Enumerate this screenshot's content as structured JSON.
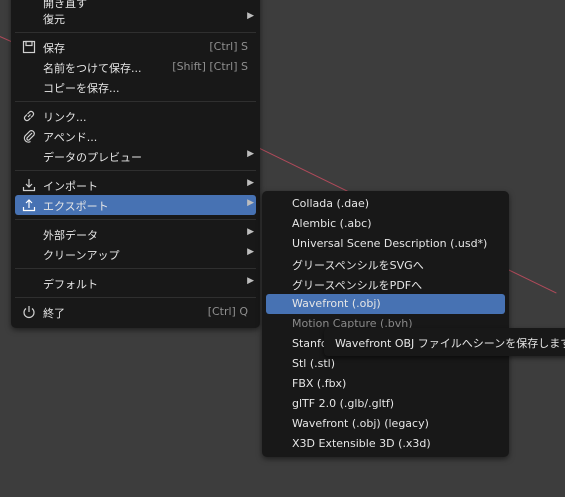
{
  "file_menu": {
    "revert_partial": "開き直す",
    "recover": "復元",
    "save": "保存",
    "save_shortcut": "[Ctrl] S",
    "save_as": "名前をつけて保存...",
    "save_as_shortcut": "[Shift] [Ctrl] S",
    "save_copy": "コピーを保存...",
    "link": "リンク...",
    "append": "アペンド...",
    "data_previews": "データのプレビュー",
    "import": "インポート",
    "export": "エクスポート",
    "external_data": "外部データ",
    "clean_up": "クリーンアップ",
    "defaults": "デフォルト",
    "quit": "終了",
    "quit_shortcut": "[Ctrl] Q"
  },
  "export_menu": {
    "items": [
      "Collada (.dae)",
      "Alembic (.abc)",
      "Universal Scene Description (.usd*)",
      "グリースペンシルをSVGへ",
      "グリースペンシルをPDFへ",
      "Wavefront (.obj)",
      "Motion Capture (.bvh)",
      "Stanford",
      "Stl (.stl)",
      "FBX (.fbx)",
      "glTF 2.0 (.glb/.gltf)",
      "Wavefront (.obj) (legacy)",
      "X3D Extensible 3D (.x3d)"
    ],
    "highlighted_index": 5
  },
  "tooltip": {
    "text": "Wavefront OBJ ファイルへシーンを保存します"
  },
  "colors": {
    "menu_bg": "#181818",
    "highlight": "#4772b3",
    "viewport_bg": "#3d3d3d"
  }
}
